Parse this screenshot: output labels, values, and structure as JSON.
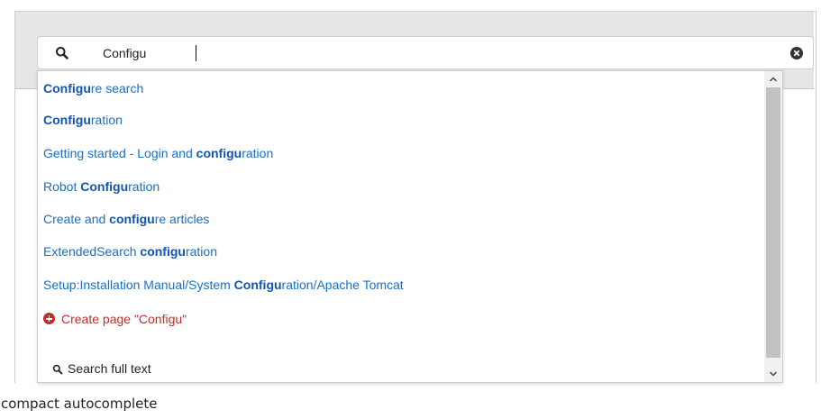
{
  "search": {
    "value": "Configu"
  },
  "results": [
    {
      "parts": [
        {
          "t": "Configu",
          "b": true
        },
        {
          "t": "re search",
          "b": false
        }
      ]
    },
    {
      "parts": [
        {
          "t": "Configu",
          "b": true
        },
        {
          "t": "ration",
          "b": false
        }
      ]
    },
    {
      "parts": [
        {
          "t": "Getting started - Login and ",
          "b": false
        },
        {
          "t": "configu",
          "b": true
        },
        {
          "t": "ration",
          "b": false
        }
      ]
    },
    {
      "parts": [
        {
          "t": "Robot ",
          "b": false
        },
        {
          "t": "Configu",
          "b": true
        },
        {
          "t": "ration",
          "b": false
        }
      ]
    },
    {
      "parts": [
        {
          "t": "Create and ",
          "b": false
        },
        {
          "t": "configu",
          "b": true
        },
        {
          "t": "re articles",
          "b": false
        }
      ]
    },
    {
      "parts": [
        {
          "t": "ExtendedSearch ",
          "b": false
        },
        {
          "t": "configu",
          "b": true
        },
        {
          "t": "ration",
          "b": false
        }
      ]
    },
    {
      "parts": [
        {
          "t": "Setup:Installation Manual/System ",
          "b": false
        },
        {
          "t": "Configu",
          "b": true
        },
        {
          "t": "ration/Apache Tomcat",
          "b": false
        }
      ]
    }
  ],
  "create_page": {
    "label": "Create page \"Configu\"",
    "icon": "plus-circle-icon",
    "color": "#c0302b"
  },
  "fulltext": {
    "label": "Search full text",
    "icon": "search-icon"
  },
  "caption": "compact autocomplete",
  "colors": {
    "link": "#1a6fc4",
    "highlight": "#1255b0",
    "toolbar_bg": "#e6e6e6"
  }
}
